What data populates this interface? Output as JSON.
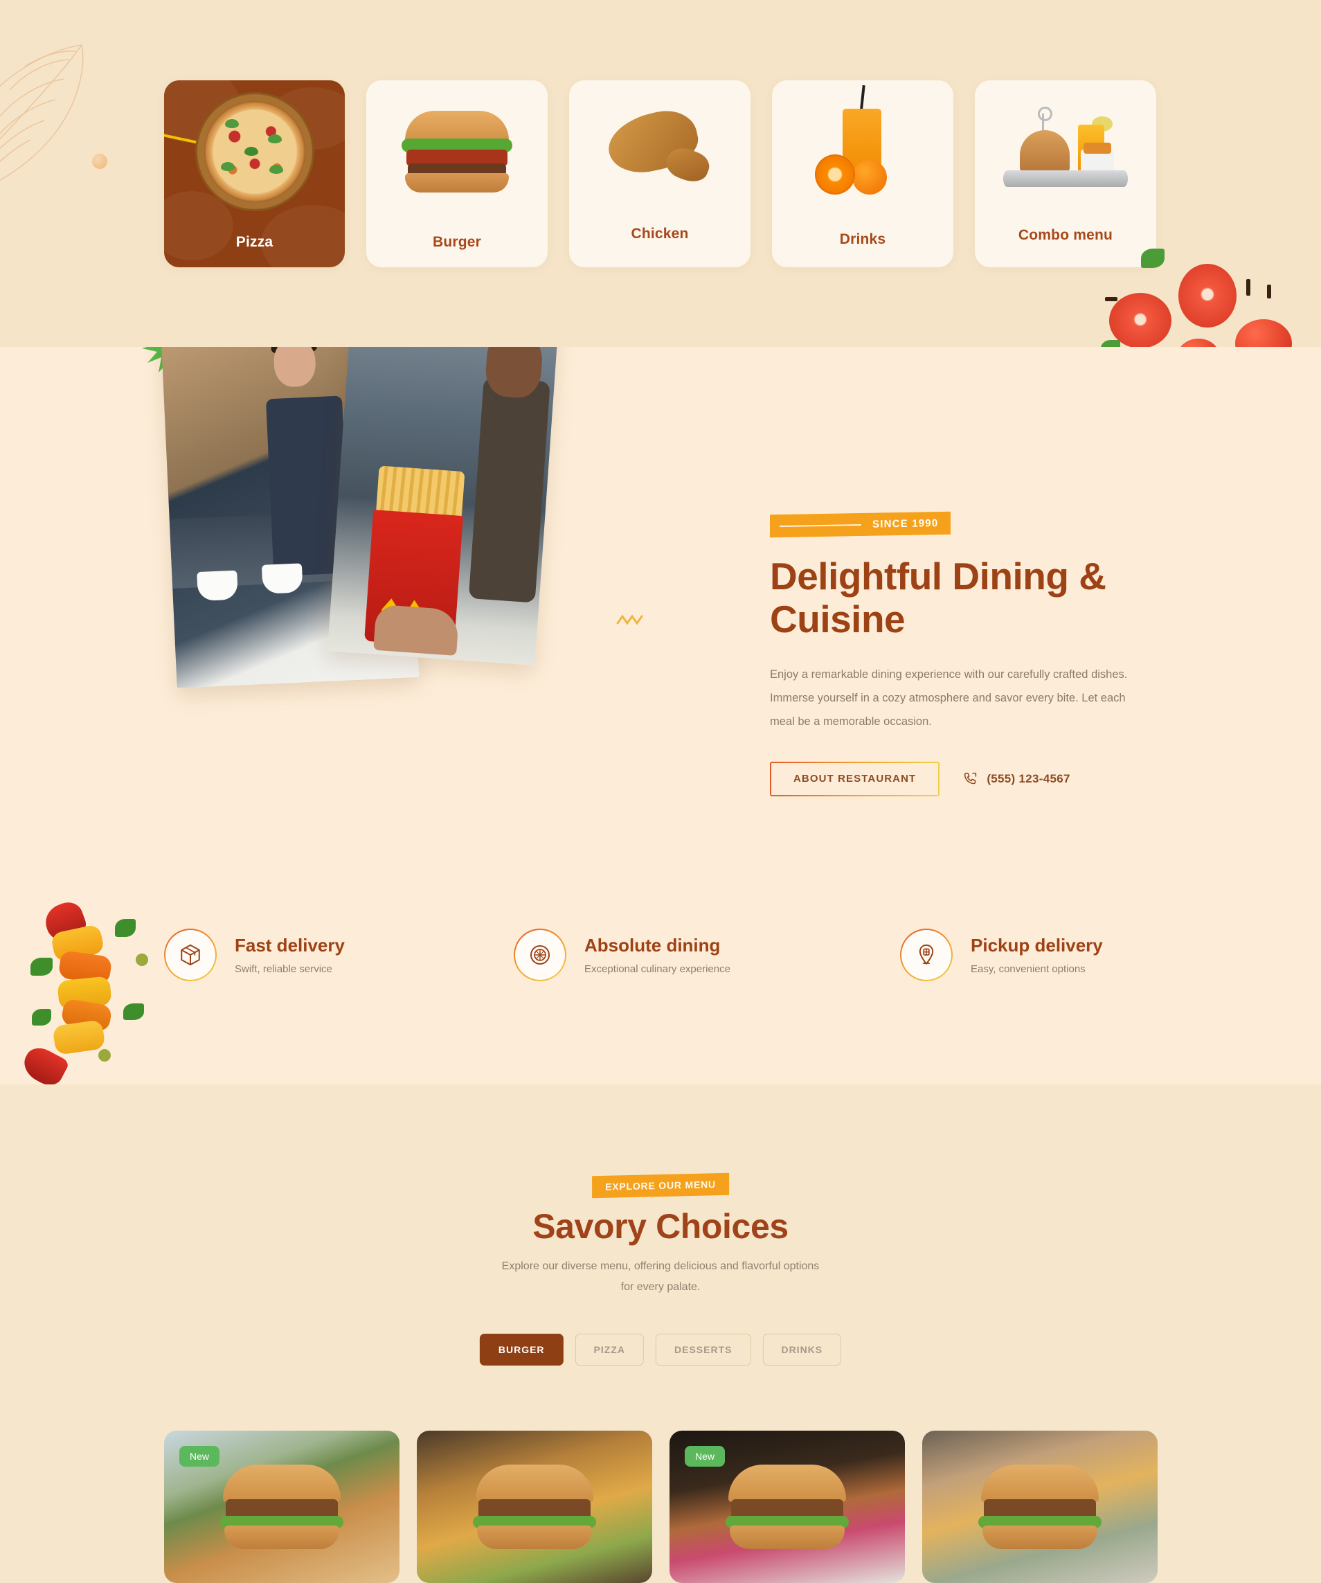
{
  "theme": {
    "bg_top": "#F5E4C8",
    "bg_middle": "#FDEDD8",
    "bg_bottom": "#F6E6CB",
    "brand_brown": "#8E3F13",
    "heading_brown": "#9D4215",
    "accent_orange": "#F5A11B",
    "badge_green": "#5CB85C",
    "card_cream": "#FDF6EC"
  },
  "categories": {
    "items": [
      {
        "label": "Pizza",
        "icon": "pizza-icon",
        "active": true
      },
      {
        "label": "Burger",
        "icon": "burger-icon",
        "active": false
      },
      {
        "label": "Chicken",
        "icon": "chicken-icon",
        "active": false
      },
      {
        "label": "Drinks",
        "icon": "drink-icon",
        "active": false
      },
      {
        "label": "Combo menu",
        "icon": "combo-menu-icon",
        "active": false
      }
    ]
  },
  "hero": {
    "badge_text": "SINCE 1990",
    "title": "Delightful Dining & Cuisine",
    "description": "Enjoy a remarkable dining experience with our carefully crafted dishes. Immerse yourself in a cozy atmosphere and savor every bite. Let each meal be a memorable occasion.",
    "about_button": "ABOUT RESTAURANT",
    "phone": "(555) 123-4567",
    "phone_icon": "phone-icon",
    "photo_left_alt": "barista-photo",
    "photo_right_alt": "fries-photo",
    "decor": [
      "green-star-icon",
      "smiley-face-icon",
      "zigzag-icon"
    ]
  },
  "features": {
    "items": [
      {
        "title": "Fast delivery",
        "subtitle": "Swift, reliable service",
        "icon": "package-box-icon"
      },
      {
        "title": "Absolute dining",
        "subtitle": "Exceptional culinary experience",
        "icon": "dining-plate-icon"
      },
      {
        "title": "Pickup delivery",
        "subtitle": "Easy, convenient options",
        "icon": "location-pin-icon"
      }
    ]
  },
  "menu": {
    "badge_text": "EXPLORE OUR MENU",
    "title": "Savory Choices",
    "subtitle": "Explore our diverse menu, offering delicious and flavorful options for every palate.",
    "filters": [
      {
        "label": "BURGER",
        "active": true
      },
      {
        "label": "PIZZA",
        "active": false
      },
      {
        "label": "DESSERTS",
        "active": false
      },
      {
        "label": "DRINKS",
        "active": false
      }
    ],
    "products": [
      {
        "badge": "New",
        "image_alt": "burger-with-sweet-potato-fries"
      },
      {
        "badge": "",
        "image_alt": "cheeseburger-with-onion-rings"
      },
      {
        "badge": "New",
        "image_alt": "burger-with-pickled-onion"
      },
      {
        "badge": "",
        "image_alt": "burger-with-fries-basket"
      }
    ]
  }
}
